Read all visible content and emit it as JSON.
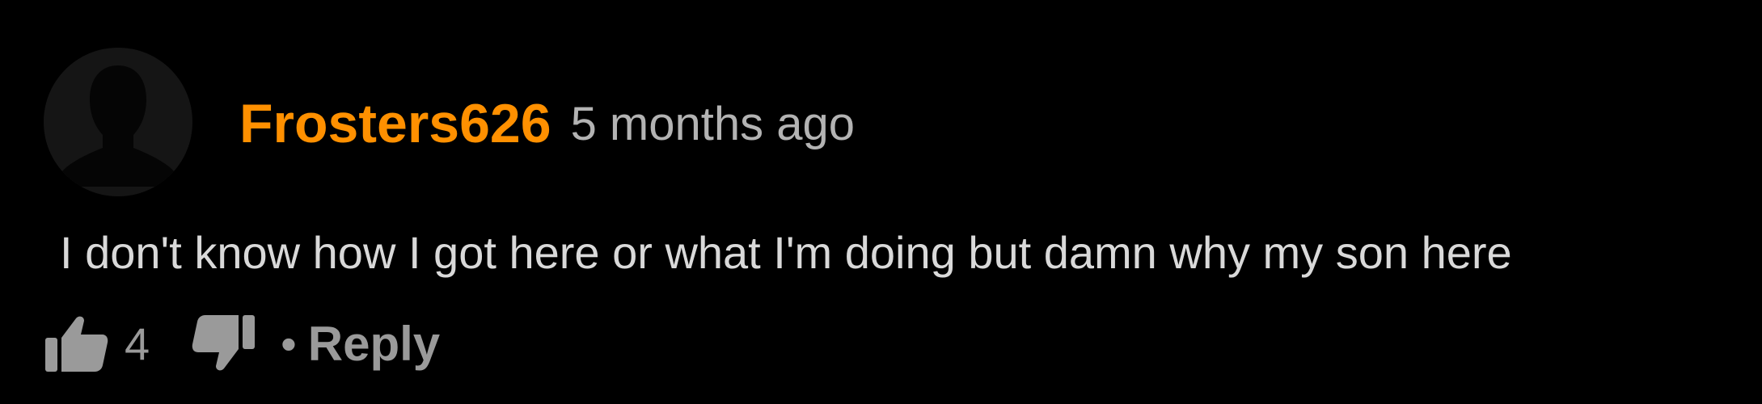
{
  "comment": {
    "username": "Frosters626",
    "timestamp": "5 months ago",
    "text": "I don't know how I got here or what I'm doing but damn why my son here",
    "likes": "4",
    "separator": "•",
    "reply_label": "Reply",
    "avatar_icon": "default-user-silhouette-icon",
    "like_icon": "thumbs-up-icon",
    "dislike_icon": "thumbs-down-icon"
  },
  "colors": {
    "background": "#000000",
    "username": "#ff9000",
    "timestamp": "#b3b3b3",
    "text": "#d9d9d9",
    "actions": "#9a9a9a",
    "avatar_bg": "#151515",
    "avatar_figure": "#050505"
  }
}
